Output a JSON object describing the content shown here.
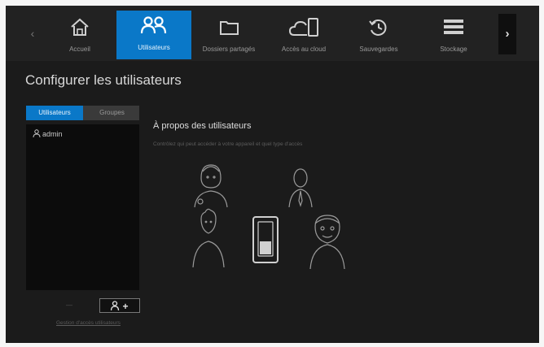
{
  "nav": {
    "items": [
      {
        "label": "Accueil",
        "icon": "home-icon"
      },
      {
        "label": "Utilisateurs",
        "icon": "users-icon",
        "active": true
      },
      {
        "label": "Dossiers partagés",
        "icon": "folder-icon"
      },
      {
        "label": "Accès au cloud",
        "icon": "cloud-device-icon"
      },
      {
        "label": "Sauvegardes",
        "icon": "history-icon"
      },
      {
        "label": "Stockage",
        "icon": "storage-icon"
      }
    ],
    "prev_glyph": "‹",
    "next_glyph": "›"
  },
  "page": {
    "title": "Configurer les utilisateurs"
  },
  "left_panel": {
    "tabs": [
      {
        "label": "Utilisateurs",
        "active": true
      },
      {
        "label": "Groupes",
        "active": false
      }
    ],
    "users": [
      {
        "name": "admin"
      }
    ],
    "remove_label": "—",
    "add_label": "+",
    "manage_link": "Gestion d'accès utilisateurs"
  },
  "about": {
    "title": "À propos des utilisateurs",
    "description": "Contrôlez qui peut accéder à votre appareil et quel type d'accès"
  },
  "colors": {
    "accent": "#0a78c8",
    "background": "#1b1b1b",
    "topbar": "#222222"
  }
}
